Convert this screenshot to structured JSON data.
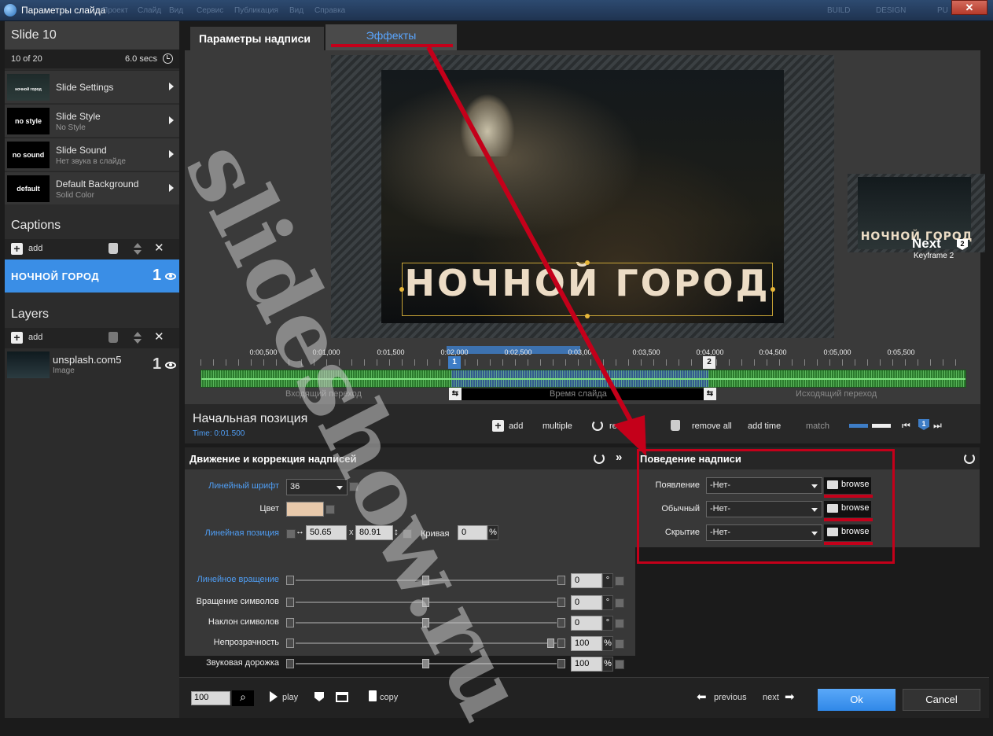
{
  "window": {
    "title": "Параметры слайда",
    "menu_ghost": [
      "Проект",
      "Слайд",
      "Вид",
      "Сервис",
      "Публикация",
      "Вид",
      "Справка"
    ],
    "mode_ghost": [
      "BUILD",
      "DESIGN",
      "PU"
    ],
    "close_glyph": "✕"
  },
  "sidebar": {
    "slide_title": "Slide 10",
    "slide_position": "10 of 20",
    "slide_duration": "6.0 secs",
    "settings": [
      {
        "thumb": "ночной город",
        "label": "Slide Settings",
        "sub": ""
      },
      {
        "thumb": "no style",
        "label": "Slide Style",
        "sub": "No Style"
      },
      {
        "thumb": "no sound",
        "label": "Slide Sound",
        "sub": "Нет звука в слайде"
      },
      {
        "thumb": "default",
        "label": "Default Background",
        "sub": "Solid Color"
      }
    ],
    "captions_title": "Captions",
    "add_label": "add",
    "caption_item": {
      "text": "НОЧНОЙ ГОРОД",
      "count": "1"
    },
    "layers_title": "Layers",
    "layer_item": {
      "name": "unsplash.com5",
      "type": "Image",
      "count": "1"
    }
  },
  "tabs": {
    "caption_params": "Параметры надписи",
    "effects": "Эффекты"
  },
  "preview": {
    "caption_text": "НОЧНОЙ ГОРОД",
    "next_caption": "НОЧНОЙ ГОРОД",
    "next_label": "Next",
    "next_badge": "2",
    "next_sub": "Keyframe 2"
  },
  "timeline": {
    "ticks": [
      "0:00,500",
      "0:01,000",
      "0:01,500",
      "0:02,000",
      "0:02,500",
      "0:03,000",
      "0:03,500",
      "0:04,000",
      "0:04,500",
      "0:05,000",
      "0:05,500"
    ],
    "marker1": "1",
    "marker2": "2",
    "intro": "Входящий переход",
    "slide_time": "Время слайда",
    "outro": "Исходящий переход"
  },
  "keyframe": {
    "title": "Начальная позиция",
    "time": "Time: 0:01.500",
    "add": "add",
    "multiple": "multiple",
    "reset_all": "reset all",
    "remove_all": "remove all",
    "add_time": "add time",
    "match": "match",
    "badge": "1"
  },
  "motion_panel": {
    "title": "Движение и коррекция надписей",
    "font_label": "Линейный шрифт",
    "font_value": "36",
    "color_label": "Цвет",
    "color_value": "#e8c9ab",
    "pos_label": "Линейная позиция",
    "pos_x": "50.65",
    "pos_sep": "x",
    "pos_y": "80.91",
    "curve_label": "Кривая",
    "curve_value": "0",
    "percent": "%",
    "degree": "°",
    "sliders": [
      {
        "label": "Линейное вращение",
        "value": "0",
        "unit": "°",
        "level": 0.5
      },
      {
        "label": "Вращение символов",
        "value": "0",
        "unit": "°",
        "level": 0.5
      },
      {
        "label": "Наклон символов",
        "value": "0",
        "unit": "°",
        "level": 0.5
      },
      {
        "label": "Непрозрачность",
        "value": "100",
        "unit": "%",
        "level": 1.0
      },
      {
        "label": "Звуковая дорожка",
        "value": "100",
        "unit": "%",
        "level": 0.5
      }
    ]
  },
  "behavior_panel": {
    "title": "Поведение надписи",
    "rows": [
      {
        "label": "Появление",
        "value": "-Нет-",
        "button": "browse"
      },
      {
        "label": "Обычный",
        "value": "-Нет-",
        "button": "browse"
      },
      {
        "label": "Скрытие",
        "value": "-Нет-",
        "button": "browse"
      }
    ]
  },
  "bottom": {
    "zoom": "100",
    "play": "play",
    "copy": "copy",
    "previous": "previous",
    "next": "next",
    "ok": "Ok",
    "cancel": "Cancel"
  },
  "watermark": "slideshow.ru",
  "colors": {
    "accent": "#3a8ee6",
    "annotation_red": "#c4001a",
    "waveform": "#2a7a2c"
  }
}
